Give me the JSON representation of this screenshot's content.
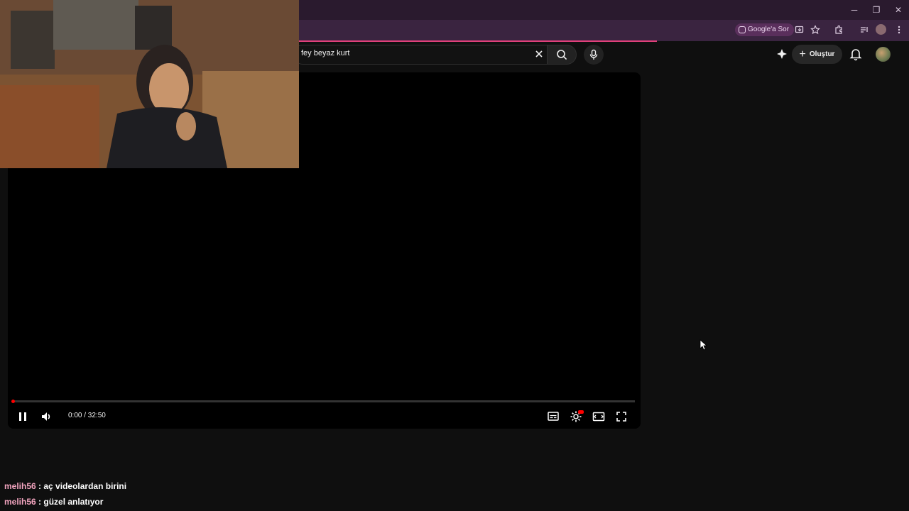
{
  "browser": {
    "ask_google_label": "Google'a Sor",
    "window_minimize": "─",
    "window_restore": "❐",
    "window_close": "✕"
  },
  "youtube": {
    "search": {
      "value": "fey beyaz kurt"
    },
    "create_label": "Oluştur"
  },
  "player": {
    "time_current": "0:00",
    "time_total": "32:50",
    "time_display": "0:00 / 32:50",
    "progress_fraction": 0.0
  },
  "chat": [
    {
      "user": "melih56",
      "message": "aç videolardan birini"
    },
    {
      "user": "melih56",
      "message": "güzel anlatıyor"
    }
  ],
  "colors": {
    "accent_red": "#ff0000",
    "chat_username": "#f4a5c0",
    "browser_frame": "#2a1a2e"
  }
}
